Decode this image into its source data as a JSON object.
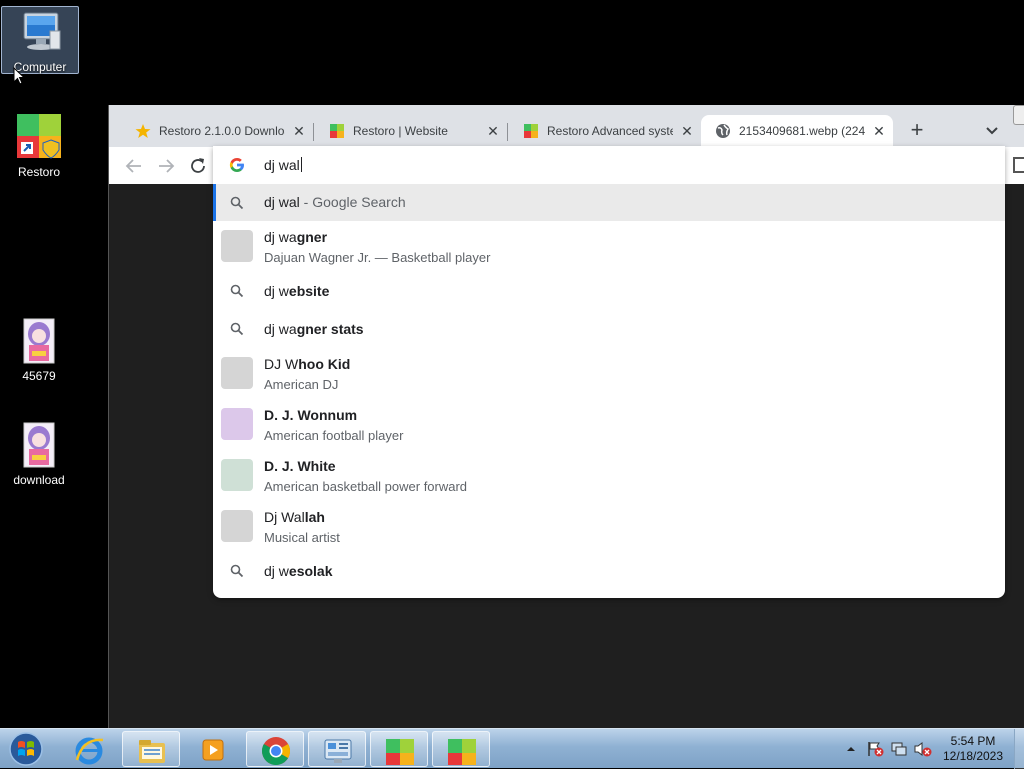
{
  "desktop": {
    "icons": [
      {
        "label": "Computer"
      },
      {
        "label": "Restoro"
      },
      {
        "label": "45679"
      },
      {
        "label": "download"
      }
    ]
  },
  "browser": {
    "tabs": [
      {
        "title": "Restoro 2.1.0.0 Downloa",
        "icon": "star-icon",
        "active": false
      },
      {
        "title": "Restoro | Website",
        "icon": "restoro-icon",
        "active": false
      },
      {
        "title": "Restoro Advanced syste",
        "icon": "restoro-icon",
        "active": false
      },
      {
        "title": "2153409681.webp (224",
        "icon": "globe-icon",
        "active": true
      }
    ],
    "new_tab_label": "+",
    "omnibox": {
      "typed_text": "dj wal",
      "suggestions": [
        {
          "prefix": "dj wal",
          "bold": "",
          "suffix": " - Google Search",
          "sub": "",
          "type": "search",
          "selected": true
        },
        {
          "prefix": "dj wa",
          "bold": "gner",
          "suffix": "",
          "sub": "Dajuan Wagner Jr. — Basketball player",
          "type": "entity",
          "thumb_color": "#d5d5d5"
        },
        {
          "prefix": "dj w",
          "bold": "ebsite",
          "suffix": "",
          "sub": "",
          "type": "search"
        },
        {
          "prefix": "dj wa",
          "bold": "gner stats",
          "suffix": "",
          "sub": "",
          "type": "search"
        },
        {
          "prefix": "DJ W",
          "bold": "hoo Kid",
          "prefix_bold": false,
          "suffix": "",
          "sub": "American DJ",
          "type": "entity",
          "thumb_color": "#d5d5d5"
        },
        {
          "prefix": "D. J. W",
          "bold": "onnum",
          "suffix": "",
          "sub": "American football player",
          "type": "entity",
          "thumb_color": "#dcc8ea"
        },
        {
          "prefix": "D. J. W",
          "bold": "hite",
          "suffix": "",
          "sub": "American basketball power forward",
          "type": "entity",
          "thumb_color": "#cfe0d6"
        },
        {
          "prefix": "Dj Wal",
          "bold": "lah",
          "suffix": "",
          "sub": "Musical artist",
          "type": "entity",
          "thumb_color": "#d5d5d5"
        },
        {
          "prefix": "dj w",
          "bold": "esolak",
          "suffix": "",
          "sub": "",
          "type": "search"
        }
      ]
    }
  },
  "taskbar": {
    "clock_time": "5:54 PM",
    "clock_date": "12/18/2023",
    "items": [
      "ie-icon",
      "explorer-icon",
      "media-player-icon",
      "chrome-icon",
      "control-panel-icon",
      "restoro-icon",
      "restoro-icon"
    ]
  }
}
